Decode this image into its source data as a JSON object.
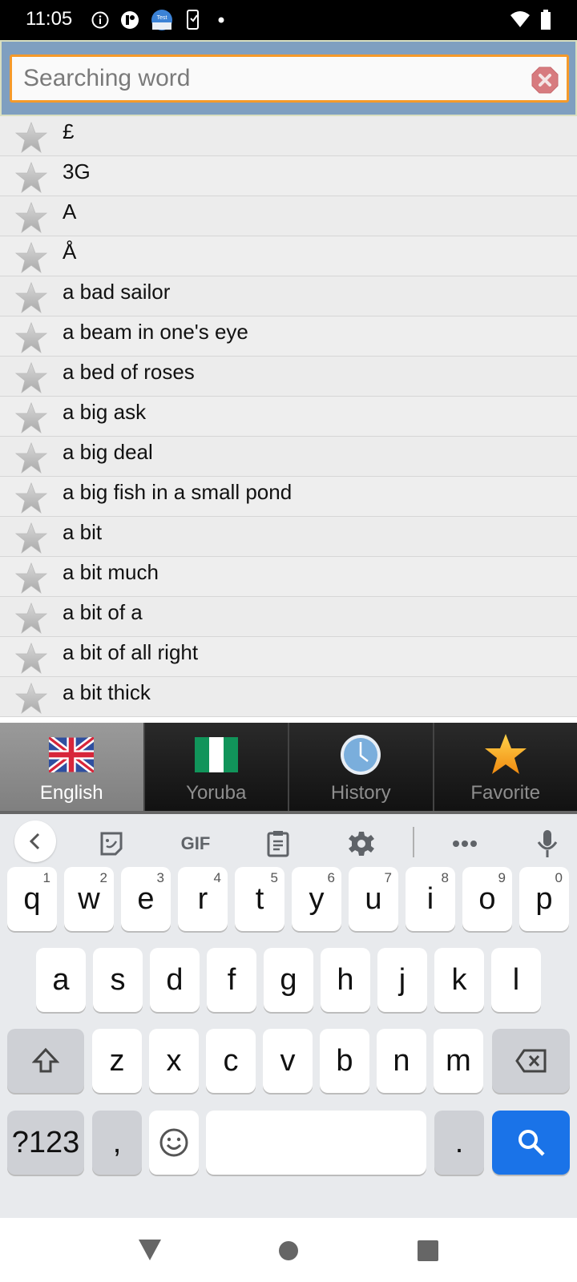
{
  "status_bar": {
    "time": "11:05",
    "icons": [
      "info-icon",
      "app-icon",
      "test-app-icon",
      "checklist-phone-icon",
      "notification-dot-icon"
    ],
    "right_icons": [
      "wifi-icon",
      "battery-icon"
    ]
  },
  "search": {
    "placeholder": "Searching word",
    "value": "",
    "clear_icon": "clear-icon",
    "colors": {
      "border": "#f59a2a",
      "background": "#7f9fc0"
    }
  },
  "word_list": {
    "items": [
      "£",
      "3G",
      "A",
      "Å",
      "a bad sailor",
      "a beam in one's eye",
      "a bed of roses",
      "a big ask",
      "a big deal",
      "a big fish in a small pond",
      "a bit",
      "a bit much",
      "a bit of a",
      "a bit of all right",
      "a bit thick"
    ],
    "favorite_icon": "star-icon"
  },
  "tabs": [
    {
      "label": "English",
      "icon": "uk-flag-icon",
      "active": true
    },
    {
      "label": "Yoruba",
      "icon": "nigeria-flag-icon",
      "active": false
    },
    {
      "label": "History",
      "icon": "clock-icon",
      "active": false
    },
    {
      "label": "Favorite",
      "icon": "star-icon",
      "active": false
    }
  ],
  "keyboard": {
    "toolbar": [
      "back-icon",
      "sticker-icon",
      "GIF",
      "clipboard-icon",
      "gear-icon",
      "more-icon",
      "mic-icon"
    ],
    "gif_label": "GIF",
    "row1": [
      {
        "key": "q",
        "hint": "1"
      },
      {
        "key": "w",
        "hint": "2"
      },
      {
        "key": "e",
        "hint": "3"
      },
      {
        "key": "r",
        "hint": "4"
      },
      {
        "key": "t",
        "hint": "5"
      },
      {
        "key": "y",
        "hint": "6"
      },
      {
        "key": "u",
        "hint": "7"
      },
      {
        "key": "i",
        "hint": "8"
      },
      {
        "key": "o",
        "hint": "9"
      },
      {
        "key": "p",
        "hint": "0"
      }
    ],
    "row2": [
      "a",
      "s",
      "d",
      "f",
      "g",
      "h",
      "j",
      "k",
      "l"
    ],
    "row3": [
      "z",
      "x",
      "c",
      "v",
      "b",
      "n",
      "m"
    ],
    "symbols_label": "?123",
    "comma_label": ",",
    "period_label": ".",
    "action_color": "#1a73e8"
  },
  "nav_bar": {
    "icons": [
      "back-triangle-icon",
      "home-circle-icon",
      "recents-square-icon"
    ]
  }
}
